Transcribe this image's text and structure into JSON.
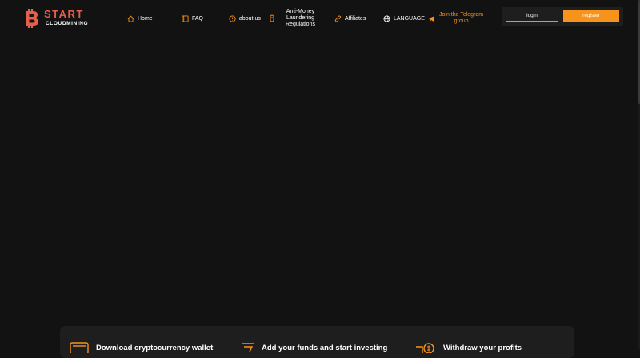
{
  "logo": {
    "title": "START",
    "subtitle": "CLOUDMINING"
  },
  "nav": {
    "home": "Home",
    "faq": "FAQ",
    "about": "about us",
    "aml": [
      "Anti-Money",
      "Laundering",
      "Regulations"
    ],
    "affiliates": "Affiliates",
    "language": "LANGUAGE",
    "telegram": [
      "Join the Telegram",
      "group"
    ]
  },
  "auth": {
    "login": "login",
    "register": "register"
  },
  "steps": [
    {
      "label": "Download cryptocurrency wallet",
      "icon": "wallet-icon"
    },
    {
      "label": "Add your funds and start investing",
      "icon": "funds-icon"
    },
    {
      "label": "Withdraw your profits",
      "icon": "withdraw-icon"
    }
  ],
  "colors": {
    "accent": "#f7931a",
    "brand": "#e4604a",
    "background": "#121212",
    "panel": "#1e1e1e"
  }
}
